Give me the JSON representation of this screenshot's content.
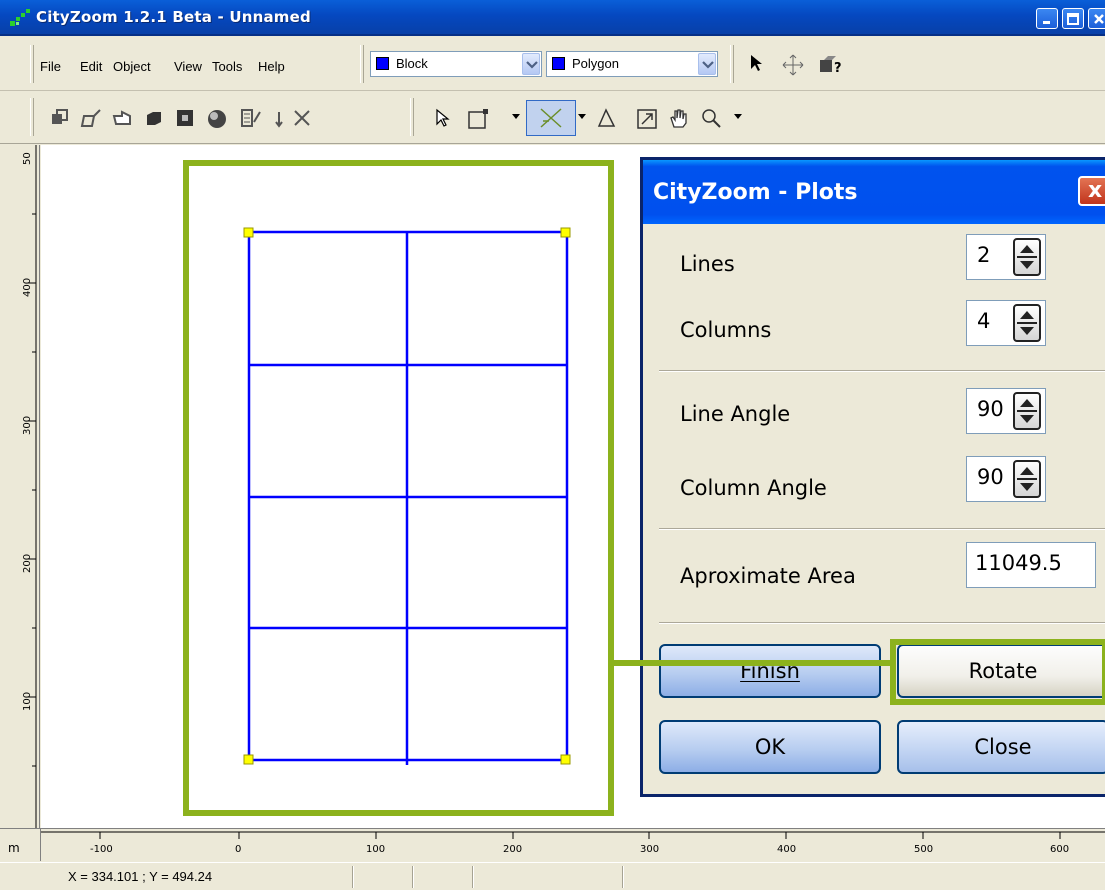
{
  "window": {
    "title": "CityZoom 1.2.1 Beta - Unnamed"
  },
  "menu": [
    "File",
    "Edit",
    "Object",
    "View",
    "Tools",
    "Help"
  ],
  "toolbar": {
    "object_type": "Block",
    "shape_type": "Polygon",
    "icons_row1": [
      "arrow-pointer-icon",
      "move-cross-icon",
      "help-pointer-icon"
    ],
    "icons_row2": [
      "copy-building-icon",
      "shear-icon",
      "hand-point-icon",
      "cube-icon",
      "square-icon",
      "sphere-icon",
      "paint-icon",
      "sort-icon",
      "delete-x-icon",
      "select-arrow-icon",
      "rectangle-icon",
      "cross-lines-icon",
      "triangle-icon",
      "resize-icon",
      "pan-hand-icon",
      "zoom-icon",
      "more-dropdown-icon"
    ]
  },
  "ruler": {
    "unit": "m",
    "x_labels": [
      "-100",
      "0",
      "100",
      "200",
      "300",
      "400",
      "500",
      "600"
    ],
    "y_labels": [
      "50",
      "400",
      "300",
      "200",
      "100"
    ]
  },
  "status": {
    "coordinates": "X = 334.101 ;  Y = 494.24"
  },
  "dialog": {
    "title": "CityZoom - Plots",
    "close_glyph": "x",
    "lines_label": "Lines",
    "lines_value": "2",
    "columns_label": "Columns",
    "columns_value": "4",
    "line_angle_label": "Line Angle",
    "line_angle_value": "90",
    "column_angle_label": "Column Angle",
    "column_angle_value": "90",
    "area_label": "Aproximate Area",
    "area_value": "11049.5",
    "finish_label": "Finish",
    "rotate_label": "Rotate",
    "ok_label": "OK",
    "close_label": "Close"
  },
  "colors": {
    "grid_lines": "#0000ff",
    "highlight": "#8cb21d",
    "corner_handles": "#ffff00"
  }
}
